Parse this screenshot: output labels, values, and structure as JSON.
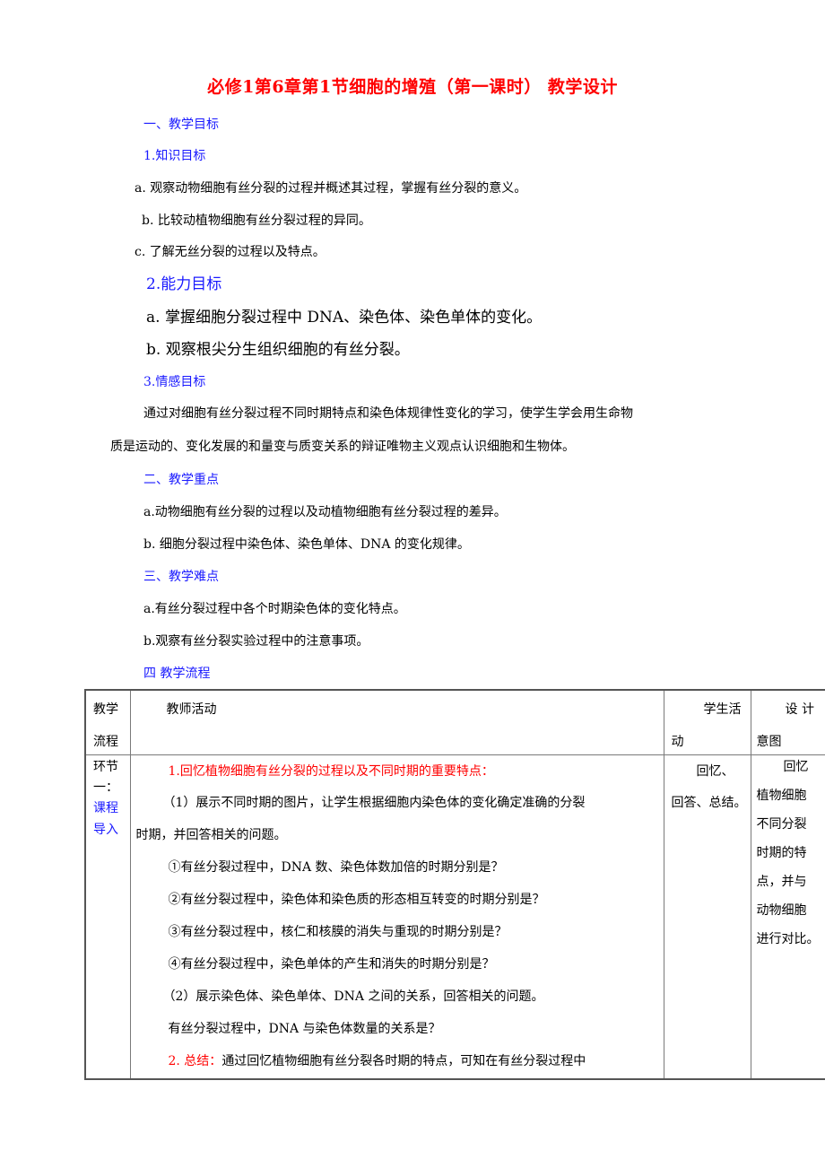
{
  "title": "必修1第6章第1节细胞的增殖（第一课时）  教学设计",
  "sections": {
    "objectives": {
      "heading": "一、教学目标",
      "knowledge": {
        "heading": "1.知识目标",
        "items": [
          "a. 观察动物细胞有丝分裂的过程并概述其过程，掌握有丝分裂的意义。",
          "b. 比较动植物细胞有丝分裂过程的异同。",
          "c. 了解无丝分裂的过程以及特点。"
        ]
      },
      "ability": {
        "heading": "2.能力目标",
        "items": [
          "a. 掌握细胞分裂过程中 DNA、染色体、染色单体的变化。",
          "b. 观察根尖分生组织细胞的有丝分裂。"
        ]
      },
      "emotion": {
        "heading": "3.情感目标",
        "paragraph_line1": "通过对细胞有丝分裂过程不同时期特点和染色体规律性变化的学习，使学生学会用生命物",
        "paragraph_line2": "质是运动的、变化发展的和量变与质变关系的辩证唯物主义观点认识细胞和生物体。"
      }
    },
    "key_points": {
      "heading": "二、教学重点",
      "items": [
        "a.动物细胞有丝分裂的过程以及动植物细胞有丝分裂过程的差异。",
        "b.  细胞分裂过程中染色体、染色单体、DNA 的变化规律。"
      ]
    },
    "difficulties": {
      "heading": "三、教学难点",
      "items": [
        "a.有丝分裂过程中各个时期染色体的变化特点。",
        "b.观察有丝分裂实验过程中的注意事项。"
      ]
    },
    "flow": {
      "heading": "四  教学流程"
    }
  },
  "table": {
    "headers": {
      "col1_line1": "教学",
      "col1_line2": "流程",
      "col2": "教师活动",
      "col3_line1": "学生活",
      "col3_line2": "动",
      "col4_line1": "设 计",
      "col4_line2": "意图"
    },
    "row1": {
      "stage_line1": "环节",
      "stage_line2": "一：",
      "stage_line3": "课程",
      "stage_line4": "导入",
      "teacher": {
        "point1": "1.回忆植物细胞有丝分裂的过程以及不同时期的重要特点：",
        "sub1_line1": "（1）展示不同时期的图片，让学生根据细胞内染色体的变化确定准确的分裂",
        "sub1_line2": "时期，并回答相关的问题。",
        "q1": "①有丝分裂过程中，DNA 数、染色体数加倍的时期分别是？",
        "q2": "②有丝分裂过程中，染色体和染色质的形态相互转变的时期分别是？",
        "q3": "③有丝分裂过程中，核仁和核膜的消失与重现的时期分别是？",
        "q4": "④有丝分裂过程中，染色单体的产生和消失的时期分别是？",
        "sub2": "（2）展示染色体、染色单体、DNA 之间的关系，回答相关的问题。",
        "q5": "有丝分裂过程中，DNA 与染色体数量的关系是？",
        "summary_label": "2.  总结：",
        "summary_text": "通过回忆植物细胞有丝分裂各时期的特点，可知在有丝分裂过程中"
      },
      "student_line1": "回忆、",
      "student_line2": "回答、总结。",
      "intent": [
        "回忆",
        "植物细胞",
        "不同分裂",
        "时期的特",
        "点，并与",
        "动物细胞",
        "进行对比。"
      ]
    }
  },
  "colors": {
    "title": "#ff0000",
    "heading": "#1a1aff",
    "body": "#000000",
    "highlight": "#ff0000"
  }
}
